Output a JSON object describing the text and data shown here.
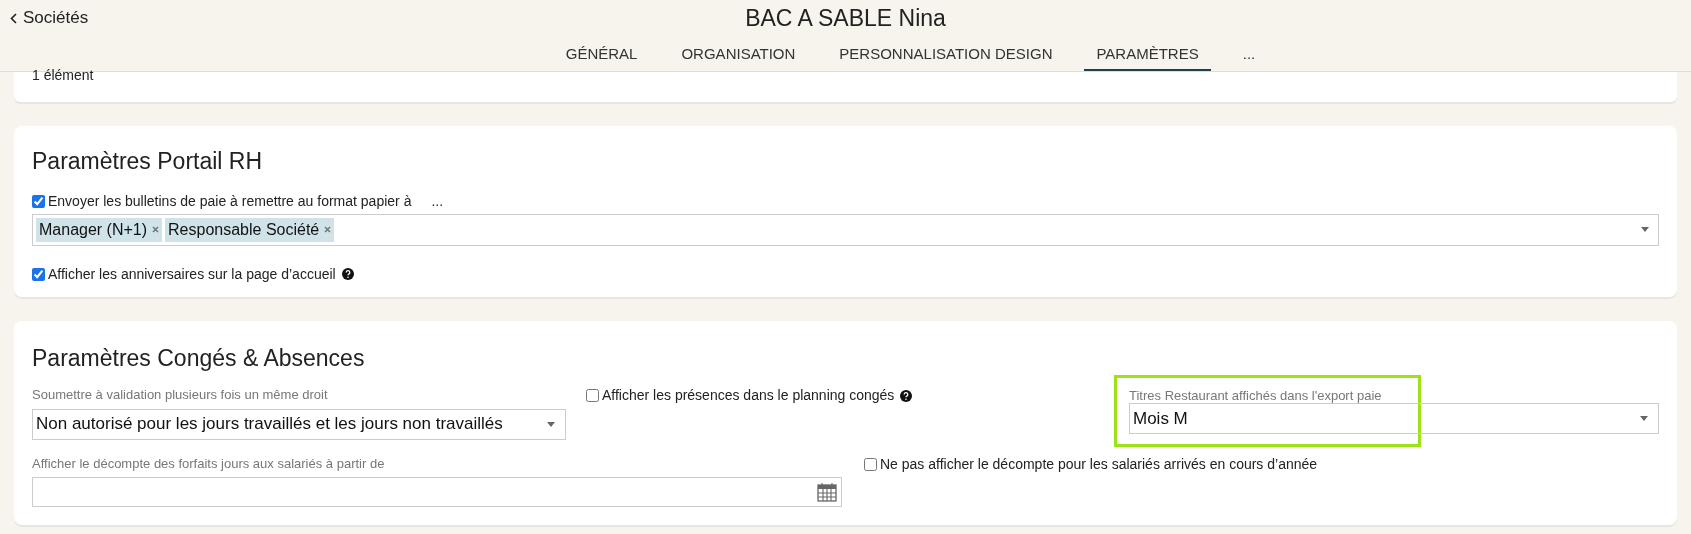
{
  "header": {
    "back_link": "Sociétés",
    "title": "BAC A SABLE Nina"
  },
  "tabs": [
    {
      "label": "GÉNÉRAL",
      "selected": false
    },
    {
      "label": "ORGANISATION",
      "selected": false
    },
    {
      "label": "PERSONNALISATION DESIGN",
      "selected": false
    },
    {
      "label": "PARAMÈTRES",
      "selected": true
    },
    {
      "label": "...",
      "selected": false
    }
  ],
  "top_card": {
    "count": "1 élément"
  },
  "portail_rh": {
    "title": "Paramètres Portail RH",
    "send_payslips": {
      "label": "Envoyer les bulletins de paie à remettre au format papier à",
      "checked": true,
      "more": "..."
    },
    "recipients": [
      "Manager (N+1)",
      "Responsable Société"
    ],
    "birthdays": {
      "label": "Afficher les anniversaires sur la page d’accueil",
      "checked": true,
      "help": true
    }
  },
  "conges": {
    "title": "Paramètres Congés & Absences",
    "validation": {
      "label": "Soumettre à validation plusieurs fois un même droit",
      "value": "Non autorisé pour les jours travaillés et les jours non travaillés"
    },
    "presences": {
      "label": "Afficher les présences dans le planning congés",
      "checked": false,
      "help": true
    },
    "titres_restaurant": {
      "label": "Titres Restaurant affichés dans l'export paie",
      "value": "Mois M",
      "highlighted": true
    },
    "forfaits": {
      "label": "Afficher le décompte des forfaits jours aux salariés à partir de"
    },
    "hide_decompte": {
      "label": "Ne pas afficher le décompte pour les salariés arrivés en cours d’année",
      "checked": false
    }
  }
}
